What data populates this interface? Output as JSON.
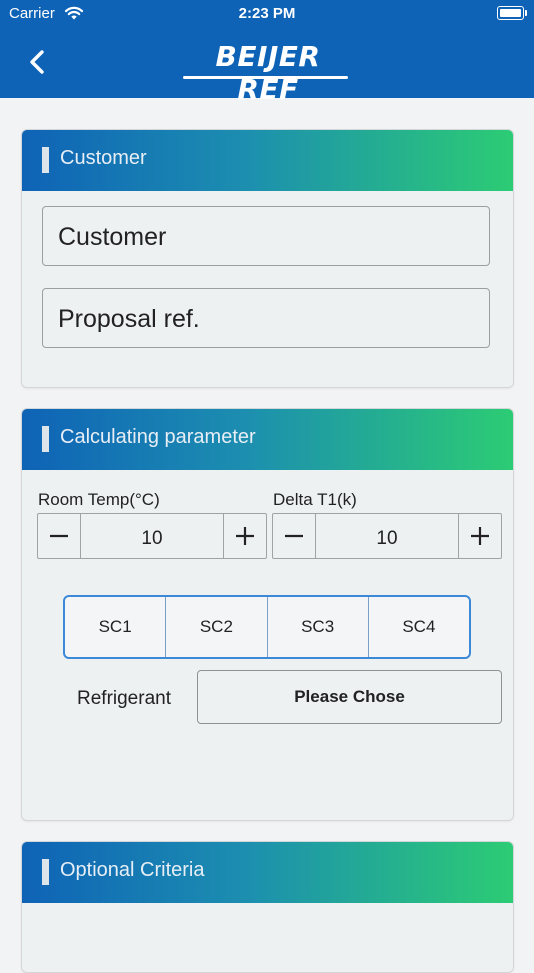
{
  "status_bar": {
    "carrier": "Carrier",
    "time": "2:23 PM"
  },
  "header": {
    "brand": "BEIJER REF"
  },
  "customer_section": {
    "title": "Customer",
    "customer_placeholder": "Customer",
    "proposal_placeholder": "Proposal ref."
  },
  "calc_section": {
    "title": "Calculating parameter",
    "room_temp": {
      "label": "Room Temp(°C)",
      "value": "10"
    },
    "delta_t1": {
      "label": "Delta T1(k)",
      "value": "10"
    },
    "segments": [
      "SC1",
      "SC2",
      "SC3",
      "SC4"
    ],
    "refrigerant_label": "Refrigerant",
    "refrigerant_button": "Please Chose"
  },
  "optional_section": {
    "title": "Optional Criteria"
  },
  "icons": [
    "wifi-icon",
    "battery-icon",
    "back-chevron-icon",
    "minus-icon",
    "plus-icon"
  ],
  "colors": {
    "header_blue": "#0f63b6",
    "gradient_green": "#2ccc74",
    "segment_border": "#3c89d8"
  }
}
